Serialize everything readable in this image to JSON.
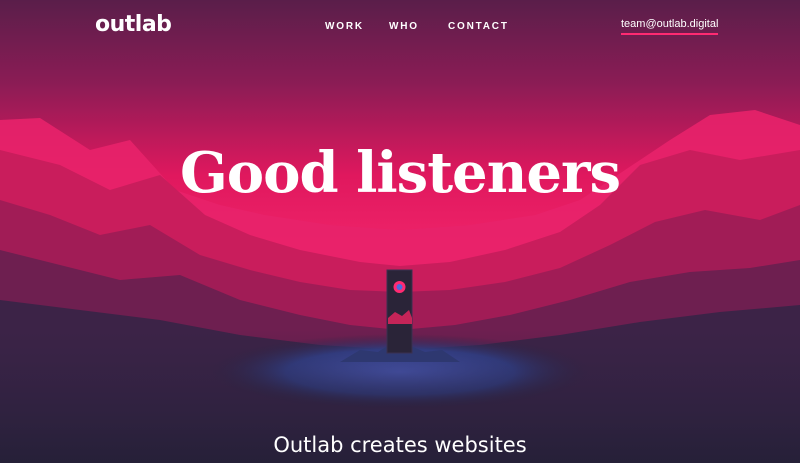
{
  "header": {
    "logo": "outlab",
    "nav": [
      "WORK",
      "WHO",
      "CONTACT"
    ],
    "email": "team@outlab.digital"
  },
  "hero": {
    "headline": "Good listeners",
    "subline": "Outlab creates websites"
  },
  "colors": {
    "accent": "#ff2a72",
    "sky_top": "#5a1e4a",
    "sky_mid": "#e0185e",
    "ground": "#2a2340",
    "water": "#3b4a9a"
  },
  "icons": {
    "monolith": "monolith-illustration"
  }
}
